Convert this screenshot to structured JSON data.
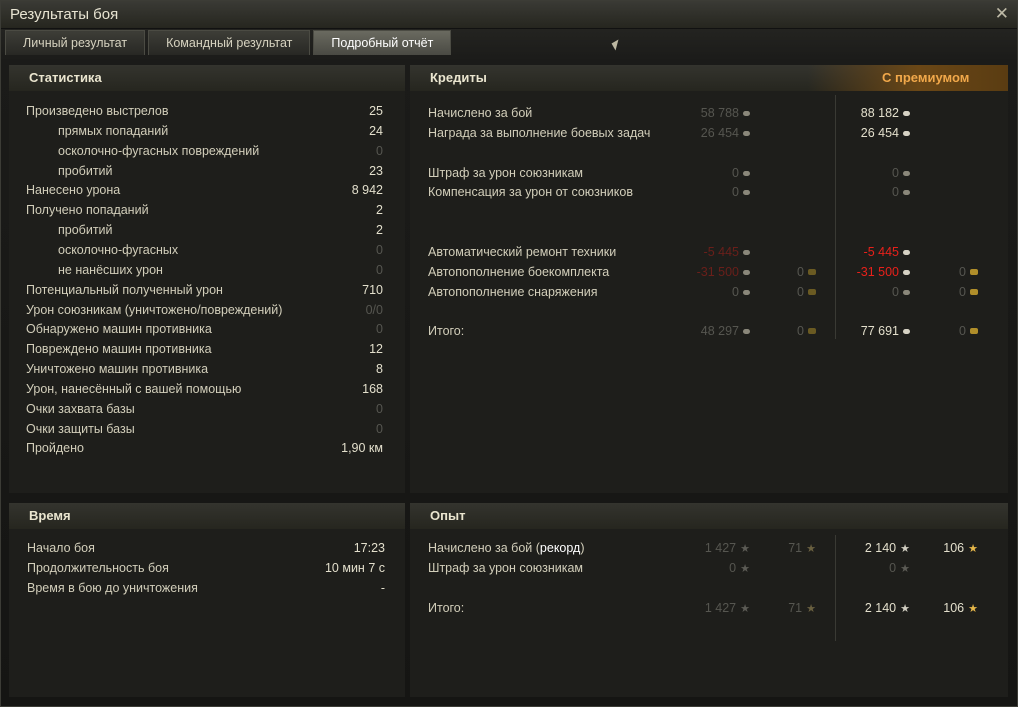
{
  "window": {
    "title": "Результаты боя",
    "close_glyph": "✕"
  },
  "tabs": [
    "Личный результат",
    "Командный результат",
    "Подробный отчёт"
  ],
  "active_tab": 2,
  "stats": {
    "title": "Статистика",
    "rows": [
      {
        "label": "Произведено выстрелов",
        "value": "25",
        "indent": false,
        "dim": false
      },
      {
        "label": "прямых попаданий",
        "value": "24",
        "indent": true,
        "dim": false
      },
      {
        "label": "осколочно-фугасных повреждений",
        "value": "0",
        "indent": true,
        "dim": true
      },
      {
        "label": "пробитий",
        "value": "23",
        "indent": true,
        "dim": false
      },
      {
        "label": "Нанесено урона",
        "value": "8 942",
        "indent": false,
        "dim": false
      },
      {
        "label": "Получено попаданий",
        "value": "2",
        "indent": false,
        "dim": false
      },
      {
        "label": "пробитий",
        "value": "2",
        "indent": true,
        "dim": false
      },
      {
        "label": "осколочно-фугасных",
        "value": "0",
        "indent": true,
        "dim": true
      },
      {
        "label": "не нанёсших урон",
        "value": "0",
        "indent": true,
        "dim": true
      },
      {
        "label": "Потенциальный полученный урон",
        "value": "710",
        "indent": false,
        "dim": false
      },
      {
        "label": "Урон союзникам (уничтожено/повреждений)",
        "value": "0/0",
        "indent": false,
        "dim": true
      },
      {
        "label": "Обнаружено машин противника",
        "value": "0",
        "indent": false,
        "dim": true
      },
      {
        "label": "Повреждено машин противника",
        "value": "12",
        "indent": false,
        "dim": false
      },
      {
        "label": "Уничтожено машин противника",
        "value": "8",
        "indent": false,
        "dim": false
      },
      {
        "label": "Урон, нанесённый с вашей помощью",
        "value": "168",
        "indent": false,
        "dim": false
      },
      {
        "label": "Очки захвата базы",
        "value": "0",
        "indent": false,
        "dim": true
      },
      {
        "label": "Очки защиты базы",
        "value": "0",
        "indent": false,
        "dim": true
      },
      {
        "label": "Пройдено",
        "value": "1,90 км",
        "indent": false,
        "dim": false
      }
    ]
  },
  "credits": {
    "title": "Кредиты",
    "premium_label": "С премиумом",
    "rows": [
      {
        "label": "Начислено за бой",
        "base": "58 788",
        "base_gold": "",
        "prem": "88 182",
        "prem_gold": "",
        "style": "normal"
      },
      {
        "label": "Награда за выполнение боевых задач",
        "base": "26 454",
        "base_gold": "",
        "prem": "26 454",
        "prem_gold": "",
        "style": "normal"
      },
      {
        "label": "",
        "base": "",
        "base_gold": "",
        "prem": "",
        "prem_gold": "",
        "style": "blank"
      },
      {
        "label": "Штраф за урон союзникам",
        "base": "0",
        "base_gold": "",
        "prem": "0",
        "prem_gold": "",
        "style": "zero"
      },
      {
        "label": "Компенсация за урон от союзников",
        "base": "0",
        "base_gold": "",
        "prem": "0",
        "prem_gold": "",
        "style": "zero"
      },
      {
        "label": "",
        "base": "",
        "base_gold": "",
        "prem": "",
        "prem_gold": "",
        "style": "blank"
      },
      {
        "label": "",
        "base": "",
        "base_gold": "",
        "prem": "",
        "prem_gold": "",
        "style": "blank"
      },
      {
        "label": "Автоматический ремонт техники",
        "base": "-5 445",
        "base_gold": "",
        "prem": "-5 445",
        "prem_gold": "",
        "style": "neg"
      },
      {
        "label": "Автопополнение боекомплекта",
        "base": "-31 500",
        "base_gold": "0",
        "prem": "-31 500",
        "prem_gold": "0",
        "style": "neg"
      },
      {
        "label": "Автопополнение снаряжения",
        "base": "0",
        "base_gold": "0",
        "prem": "0",
        "prem_gold": "0",
        "style": "zero"
      },
      {
        "label": "",
        "base": "",
        "base_gold": "",
        "prem": "",
        "prem_gold": "",
        "style": "blank"
      },
      {
        "label": "Итого:",
        "base": "48 297",
        "base_gold": "0",
        "prem": "77 691",
        "prem_gold": "0",
        "style": "total"
      }
    ]
  },
  "time": {
    "title": "Время",
    "rows": [
      {
        "label": "Начало боя",
        "value": "17:23"
      },
      {
        "label": "Продолжительность боя",
        "value": "10 мин 7 с"
      },
      {
        "label": "Время в бою до уничтожения",
        "value": "-"
      }
    ]
  },
  "experience": {
    "title": "Опыт",
    "rows": [
      {
        "label_pre": "Начислено за бой (",
        "label_hi": "рекорд",
        "label_post": ")",
        "base": "1 427",
        "base_free": "71",
        "prem": "2 140",
        "prem_free": "106",
        "style": "normal"
      },
      {
        "label_pre": "Штраф за урон союзникам",
        "label_hi": "",
        "label_post": "",
        "base": "0",
        "base_free": "",
        "prem": "0",
        "prem_free": "",
        "style": "zero"
      },
      {
        "label_pre": "",
        "label_hi": "",
        "label_post": "",
        "base": "",
        "base_free": "",
        "prem": "",
        "prem_free": "",
        "style": "blank"
      },
      {
        "label_pre": "Итого:",
        "label_hi": "",
        "label_post": "",
        "base": "1 427",
        "base_free": "71",
        "prem": "2 140",
        "prem_free": "106",
        "style": "normal"
      }
    ]
  },
  "icons": {
    "credit": "silver-coin-icon",
    "gold": "gold-coin-icon",
    "xp": "star-icon",
    "free_xp": "gold-star-icon"
  }
}
